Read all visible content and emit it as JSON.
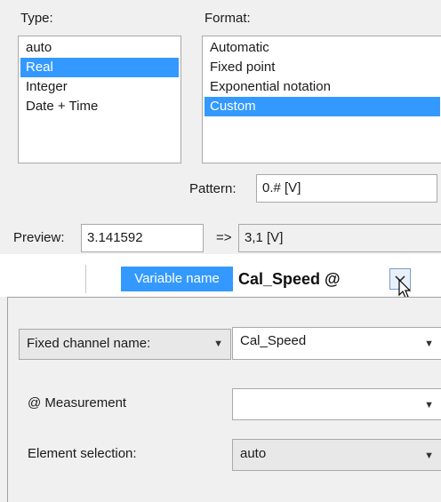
{
  "format_panel": {
    "type_label": "Type:",
    "format_label": "Format:",
    "type_items": [
      {
        "label": "auto",
        "selected": false
      },
      {
        "label": "Real",
        "selected": true
      },
      {
        "label": "Integer",
        "selected": false
      },
      {
        "label": "Date + Time",
        "selected": false
      }
    ],
    "format_items": [
      {
        "label": "Automatic",
        "selected": false
      },
      {
        "label": "Fixed point",
        "selected": false
      },
      {
        "label": "Exponential notation",
        "selected": false
      },
      {
        "label": "Custom",
        "selected": true
      }
    ],
    "pattern_label": "Pattern:",
    "pattern_value": "0.# [V]",
    "preview_label": "Preview:",
    "preview_value": "3.141592",
    "arrow_text": "=>",
    "preview_result": "3,1 [V]"
  },
  "variable": {
    "header_label": "Variable name",
    "value": "Cal_Speed @"
  },
  "channel": {
    "mode_label": "Fixed channel name:",
    "name_value": "Cal_Speed",
    "measurement_label": "@ Measurement",
    "measurement_value": "",
    "element_label": "Element selection:",
    "element_value": "auto"
  },
  "colors": {
    "selection": "#3399ff",
    "panel_bg": "#f0f0f0"
  }
}
